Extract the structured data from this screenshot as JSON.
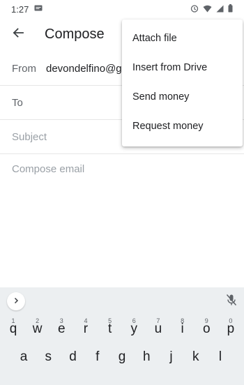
{
  "status": {
    "time": "1:27",
    "icons": [
      "message-notification-icon",
      "alarm-icon",
      "wifi-icon",
      "signal-icon",
      "battery-icon"
    ]
  },
  "app_bar": {
    "title": "Compose",
    "back_icon": "arrow-back-icon"
  },
  "fields": {
    "from_label": "From",
    "from_value": "devondelfino@gm",
    "to_label": "To",
    "subject_placeholder": "Subject",
    "body_placeholder": "Compose email"
  },
  "menu": {
    "items": [
      {
        "label": "Attach file"
      },
      {
        "label": "Insert from Drive"
      },
      {
        "label": "Send money"
      },
      {
        "label": "Request money"
      }
    ]
  },
  "keyboard": {
    "expand_icon": "chevron-right-icon",
    "mic_icon": "mic-off-icon",
    "row1": [
      {
        "key": "q",
        "hint": "1"
      },
      {
        "key": "w",
        "hint": "2"
      },
      {
        "key": "e",
        "hint": "3"
      },
      {
        "key": "r",
        "hint": "4"
      },
      {
        "key": "t",
        "hint": "5"
      },
      {
        "key": "y",
        "hint": "6"
      },
      {
        "key": "u",
        "hint": "7"
      },
      {
        "key": "i",
        "hint": "8"
      },
      {
        "key": "o",
        "hint": "9"
      },
      {
        "key": "p",
        "hint": "0"
      }
    ],
    "row2": [
      {
        "key": "a"
      },
      {
        "key": "s"
      },
      {
        "key": "d"
      },
      {
        "key": "f"
      },
      {
        "key": "g"
      },
      {
        "key": "h"
      },
      {
        "key": "j"
      },
      {
        "key": "k"
      },
      {
        "key": "l"
      }
    ]
  }
}
